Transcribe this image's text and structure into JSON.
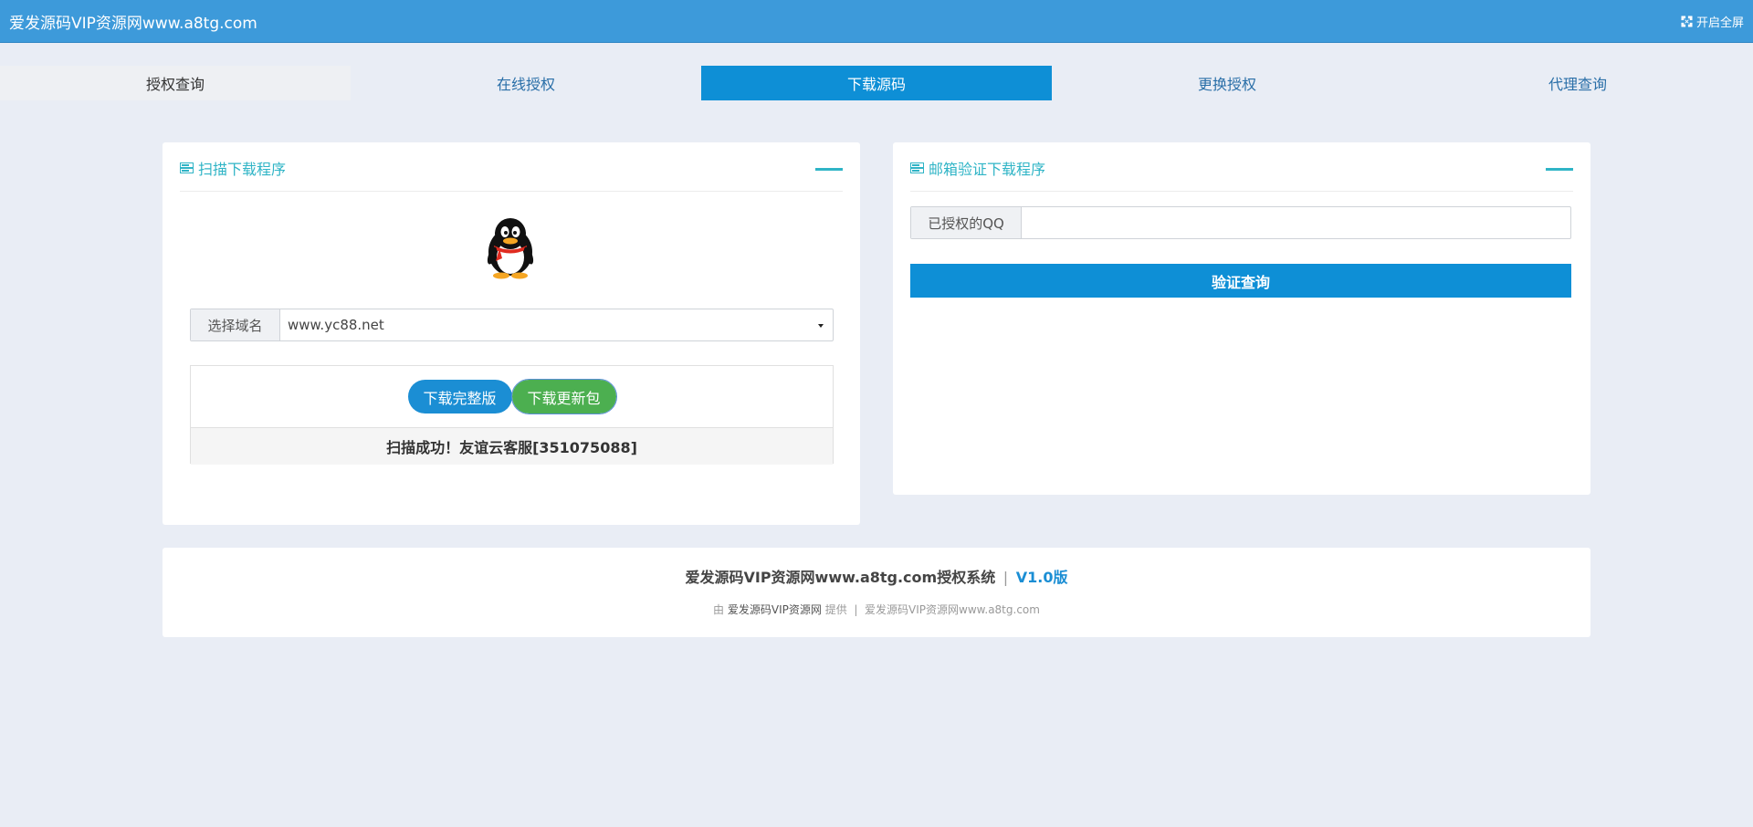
{
  "header": {
    "title": "爱发源码VIP资源网www.a8tg.com",
    "fullscreen_label": "开启全屏"
  },
  "tabs": [
    {
      "label": "授权查询"
    },
    {
      "label": "在线授权"
    },
    {
      "label": "下载源码",
      "active": true
    },
    {
      "label": "更换授权"
    },
    {
      "label": "代理查询"
    }
  ],
  "scan_panel": {
    "title": "扫描下载程序",
    "domain_label": "选择域名",
    "domain_selected": "www.yc88.net",
    "download_full_label": "下载完整版",
    "download_update_label": "下载更新包",
    "status_text": "扫描成功！友谊云客服[351075088]"
  },
  "email_panel": {
    "title": "邮箱验证下载程序",
    "qq_label": "已授权的QQ",
    "qq_value": "",
    "verify_label": "验证查询"
  },
  "footer": {
    "system_name": "爱发源码VIP资源网www.a8tg.com授权系统",
    "separator": "|",
    "version": "V1.0版",
    "by": "由",
    "provider": "爱发源码VIP资源网",
    "provided": "提供",
    "divider": "|",
    "site": "爱发源码VIP资源网www.a8tg.com"
  },
  "colors": {
    "header_bg": "#3d9ada",
    "accent": "#0e8fd6",
    "panel_title": "#2fb4c6",
    "success": "#4caf50"
  }
}
